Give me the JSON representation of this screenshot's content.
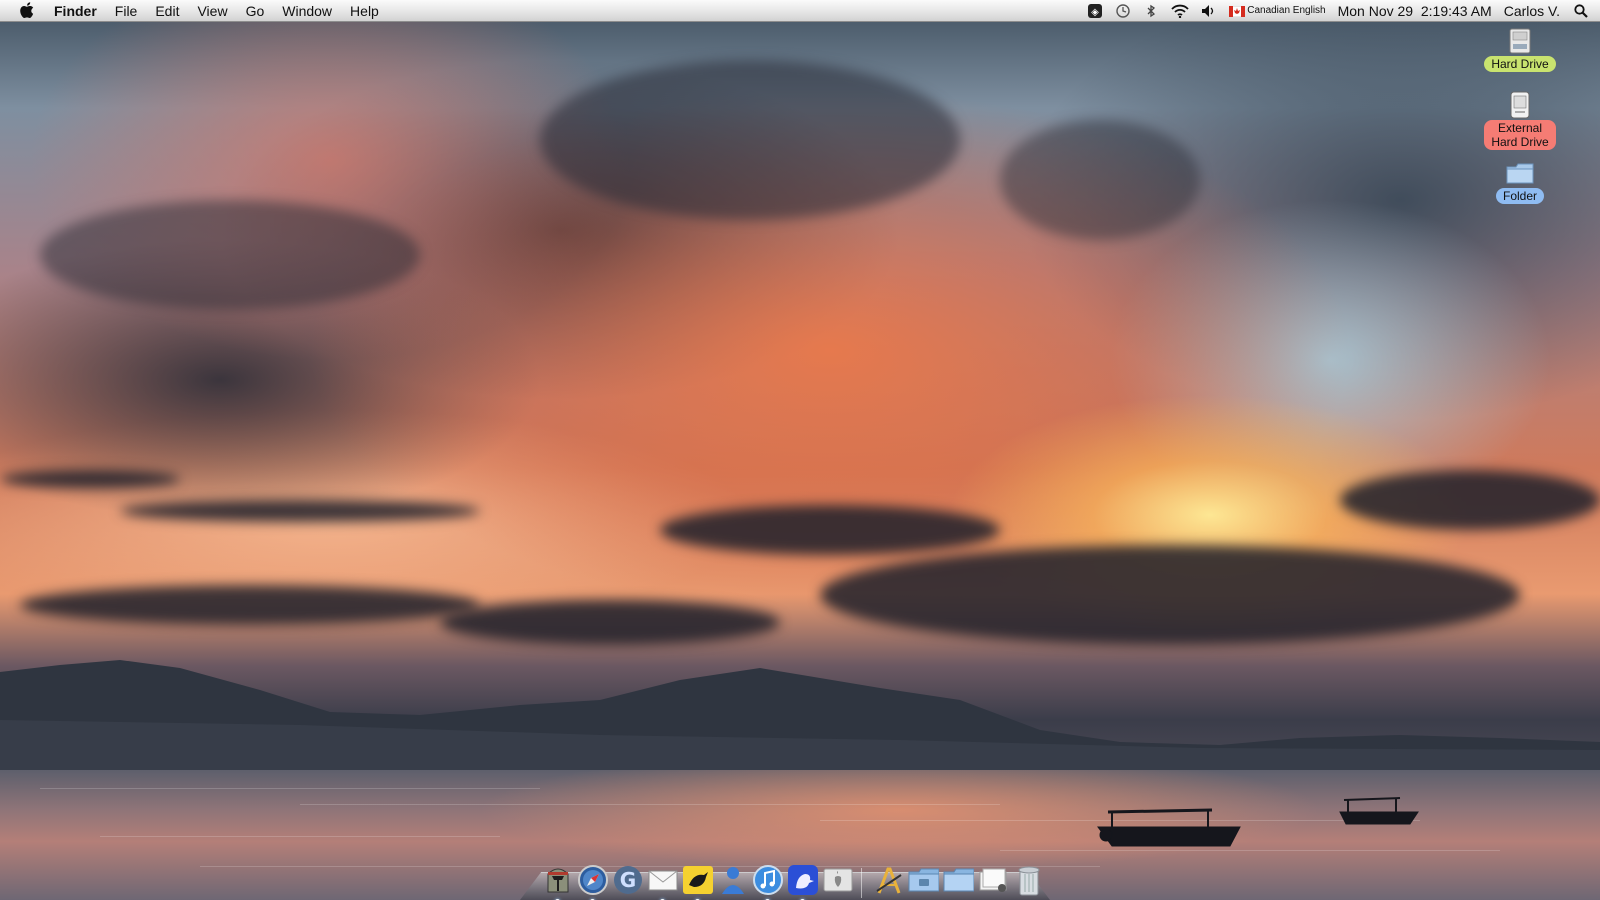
{
  "menubar": {
    "apple_icon": "apple-icon",
    "app_name": "Finder",
    "menus": [
      "File",
      "Edit",
      "View",
      "Go",
      "Window",
      "Help"
    ],
    "status_icons": [
      "dashboard-icon",
      "time-machine-icon",
      "bluetooth-icon",
      "wifi-icon",
      "volume-icon"
    ],
    "input_source_flag": "canada-flag-icon",
    "input_source": "Canadian English",
    "datetime": "Mon Nov 29  2:19:43 AM",
    "user": "Carlos V.",
    "spotlight_icon": "spotlight-icon"
  },
  "desktop": {
    "icons": [
      {
        "label": "Hard Drive",
        "icon": "hard-drive-icon",
        "label_color": "#c9e36f"
      },
      {
        "label": "External\nHard Drive",
        "icon": "external-drive-icon",
        "label_color": "#f57c74"
      },
      {
        "label": "Folder",
        "icon": "folder-icon",
        "label_color": "#8fbcf2"
      }
    ]
  },
  "dock": {
    "apps": [
      {
        "name": "boba-fett-app-icon"
      },
      {
        "name": "safari-icon"
      },
      {
        "name": "google-icon"
      },
      {
        "name": "mail-icon"
      },
      {
        "name": "twitter-bird-icon"
      },
      {
        "name": "ichat-icon"
      },
      {
        "name": "itunes-icon"
      },
      {
        "name": "adium-duck-icon"
      },
      {
        "name": "app-store-icon"
      }
    ],
    "stacks": [
      {
        "name": "applications-stack-icon"
      },
      {
        "name": "pictures-folder-icon"
      },
      {
        "name": "documents-folder-icon"
      },
      {
        "name": "downloads-stack-icon"
      },
      {
        "name": "trash-icon"
      }
    ]
  }
}
